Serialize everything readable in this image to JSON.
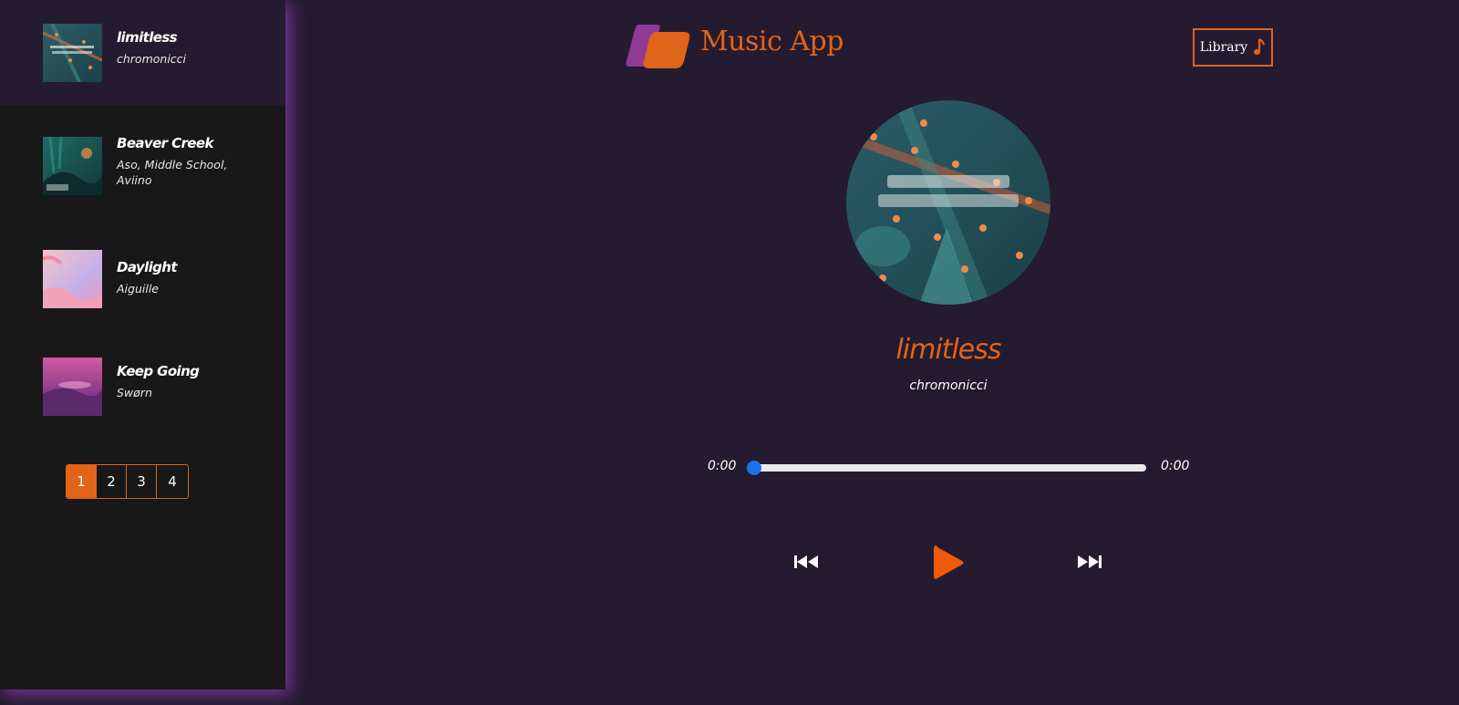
{
  "app": {
    "title": "Music App",
    "library_label": "Library"
  },
  "colors": {
    "accent": "#e0641a",
    "background": "#251b30",
    "sidebar": "#181818",
    "progress": "#1a73f0"
  },
  "sidebar": {
    "songs": [
      {
        "title": "limitless",
        "artist": "chromonicci",
        "active": true
      },
      {
        "title": "Beaver Creek",
        "artist": "Aso, Middle School, Aviino",
        "active": false
      },
      {
        "title": "Daylight",
        "artist": "Aiguille",
        "active": false
      },
      {
        "title": "Keep Going",
        "artist": "Swørn",
        "active": false
      }
    ],
    "pages": [
      "1",
      "2",
      "3",
      "4"
    ],
    "current_page": "1"
  },
  "player": {
    "title": "limitless",
    "artist": "chromonicci",
    "current_time": "0:00",
    "duration": "0:00",
    "progress": 0,
    "icons": [
      "previous-track-icon",
      "play-icon",
      "next-track-icon",
      "music-note-icon"
    ]
  }
}
